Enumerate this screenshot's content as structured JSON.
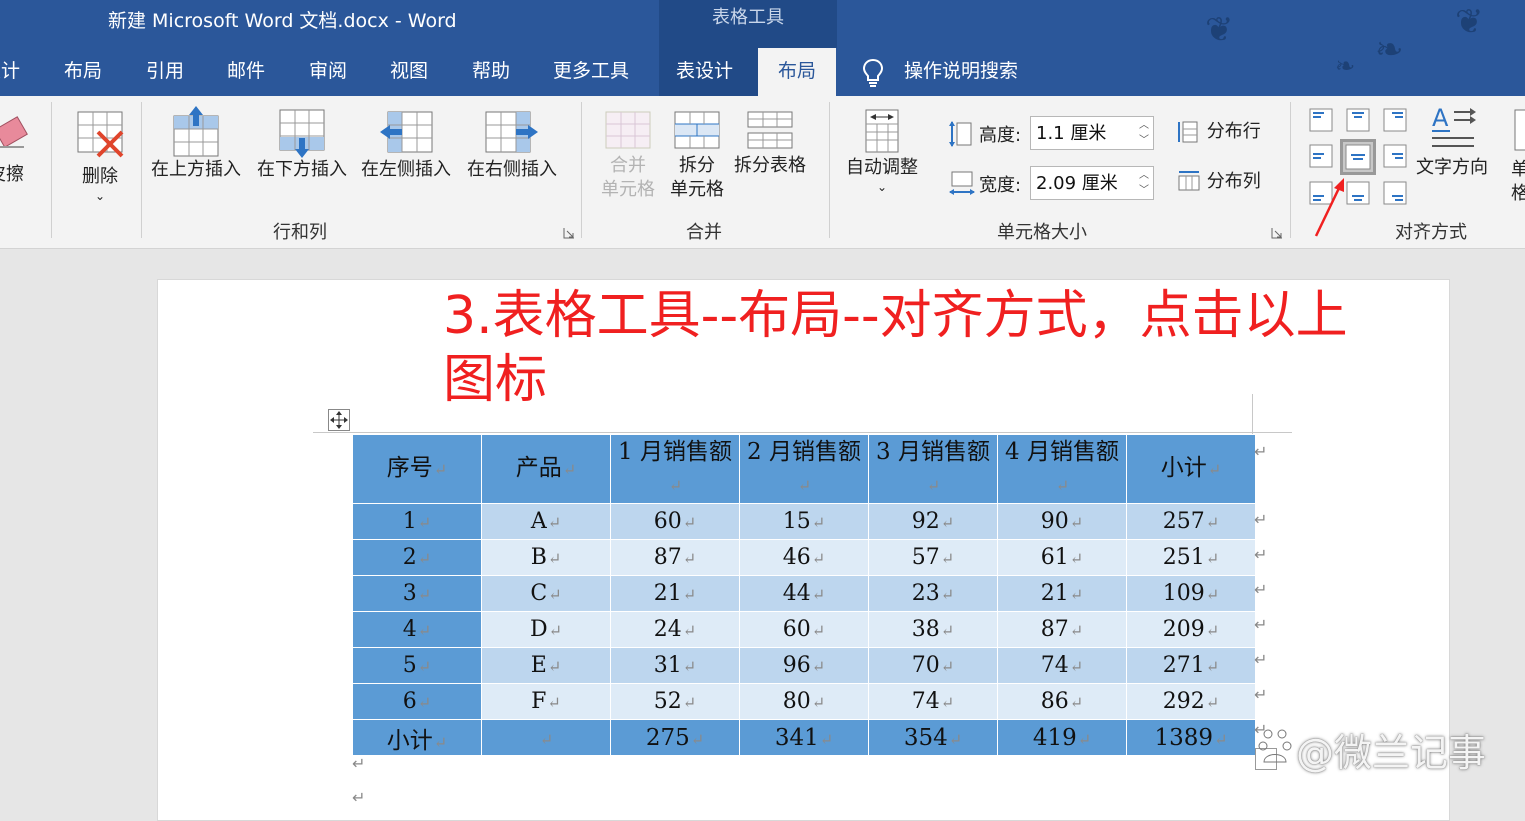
{
  "titlebar": {
    "title": "新建 Microsoft Word 文档.docx  -  Word",
    "contextual_label": "表格工具"
  },
  "tabs": [
    {
      "label": "设计"
    },
    {
      "label": "布局"
    },
    {
      "label": "引用"
    },
    {
      "label": "邮件"
    },
    {
      "label": "审阅"
    },
    {
      "label": "视图"
    },
    {
      "label": "帮助"
    },
    {
      "label": "更多工具"
    },
    {
      "label": "表设计"
    },
    {
      "label": "布局"
    }
  ],
  "tell_me": "操作说明搜索",
  "ribbon": {
    "eraser": "橡皮擦",
    "delete": "删除",
    "insert_above": "在上方插入",
    "insert_below": "在下方插入",
    "insert_left": "在左侧插入",
    "insert_right": "在右侧插入",
    "rows_cols_group": "行和列",
    "merge_cells_1": "合并",
    "merge_cells_2": "单元格",
    "split_cells_1": "拆分",
    "split_cells_2": "单元格",
    "split_table": "拆分表格",
    "merge_group": "合并",
    "autofit": "自动调整",
    "height_label": "高度:",
    "height_value": "1.1 厘米",
    "width_label": "宽度:",
    "width_value": "2.09 厘米",
    "distribute_rows": "分布行",
    "distribute_cols": "分布列",
    "cell_size_group": "单元格大小",
    "text_direction": "文字方向",
    "cell_margins_1": "单",
    "cell_margins_2": "格",
    "alignment_group": "对齐方式"
  },
  "document": {
    "caption": "3.表格工具--布局--对齐方式，点击以上图标",
    "table": {
      "headers": [
        "序号",
        "产品",
        "1 月销售额",
        "2 月销售额",
        "3 月销售额",
        "4 月销售额",
        "小计"
      ],
      "rows": [
        [
          "1",
          "A",
          "60",
          "15",
          "92",
          "90",
          "257"
        ],
        [
          "2",
          "B",
          "87",
          "46",
          "57",
          "61",
          "251"
        ],
        [
          "3",
          "C",
          "21",
          "44",
          "23",
          "21",
          "109"
        ],
        [
          "4",
          "D",
          "24",
          "60",
          "38",
          "87",
          "209"
        ],
        [
          "5",
          "E",
          "31",
          "96",
          "70",
          "74",
          "271"
        ],
        [
          "6",
          "F",
          "52",
          "80",
          "74",
          "86",
          "292"
        ]
      ],
      "totals": [
        "小计",
        "",
        "275",
        "341",
        "354",
        "419",
        "1389"
      ]
    }
  },
  "watermark": "@微兰记事",
  "colors": {
    "title_blue": "#2b579a",
    "table_header": "#5b9bd5",
    "table_odd": "#bdd6ee",
    "table_even": "#deebf7",
    "caption_red": "#f02020"
  }
}
